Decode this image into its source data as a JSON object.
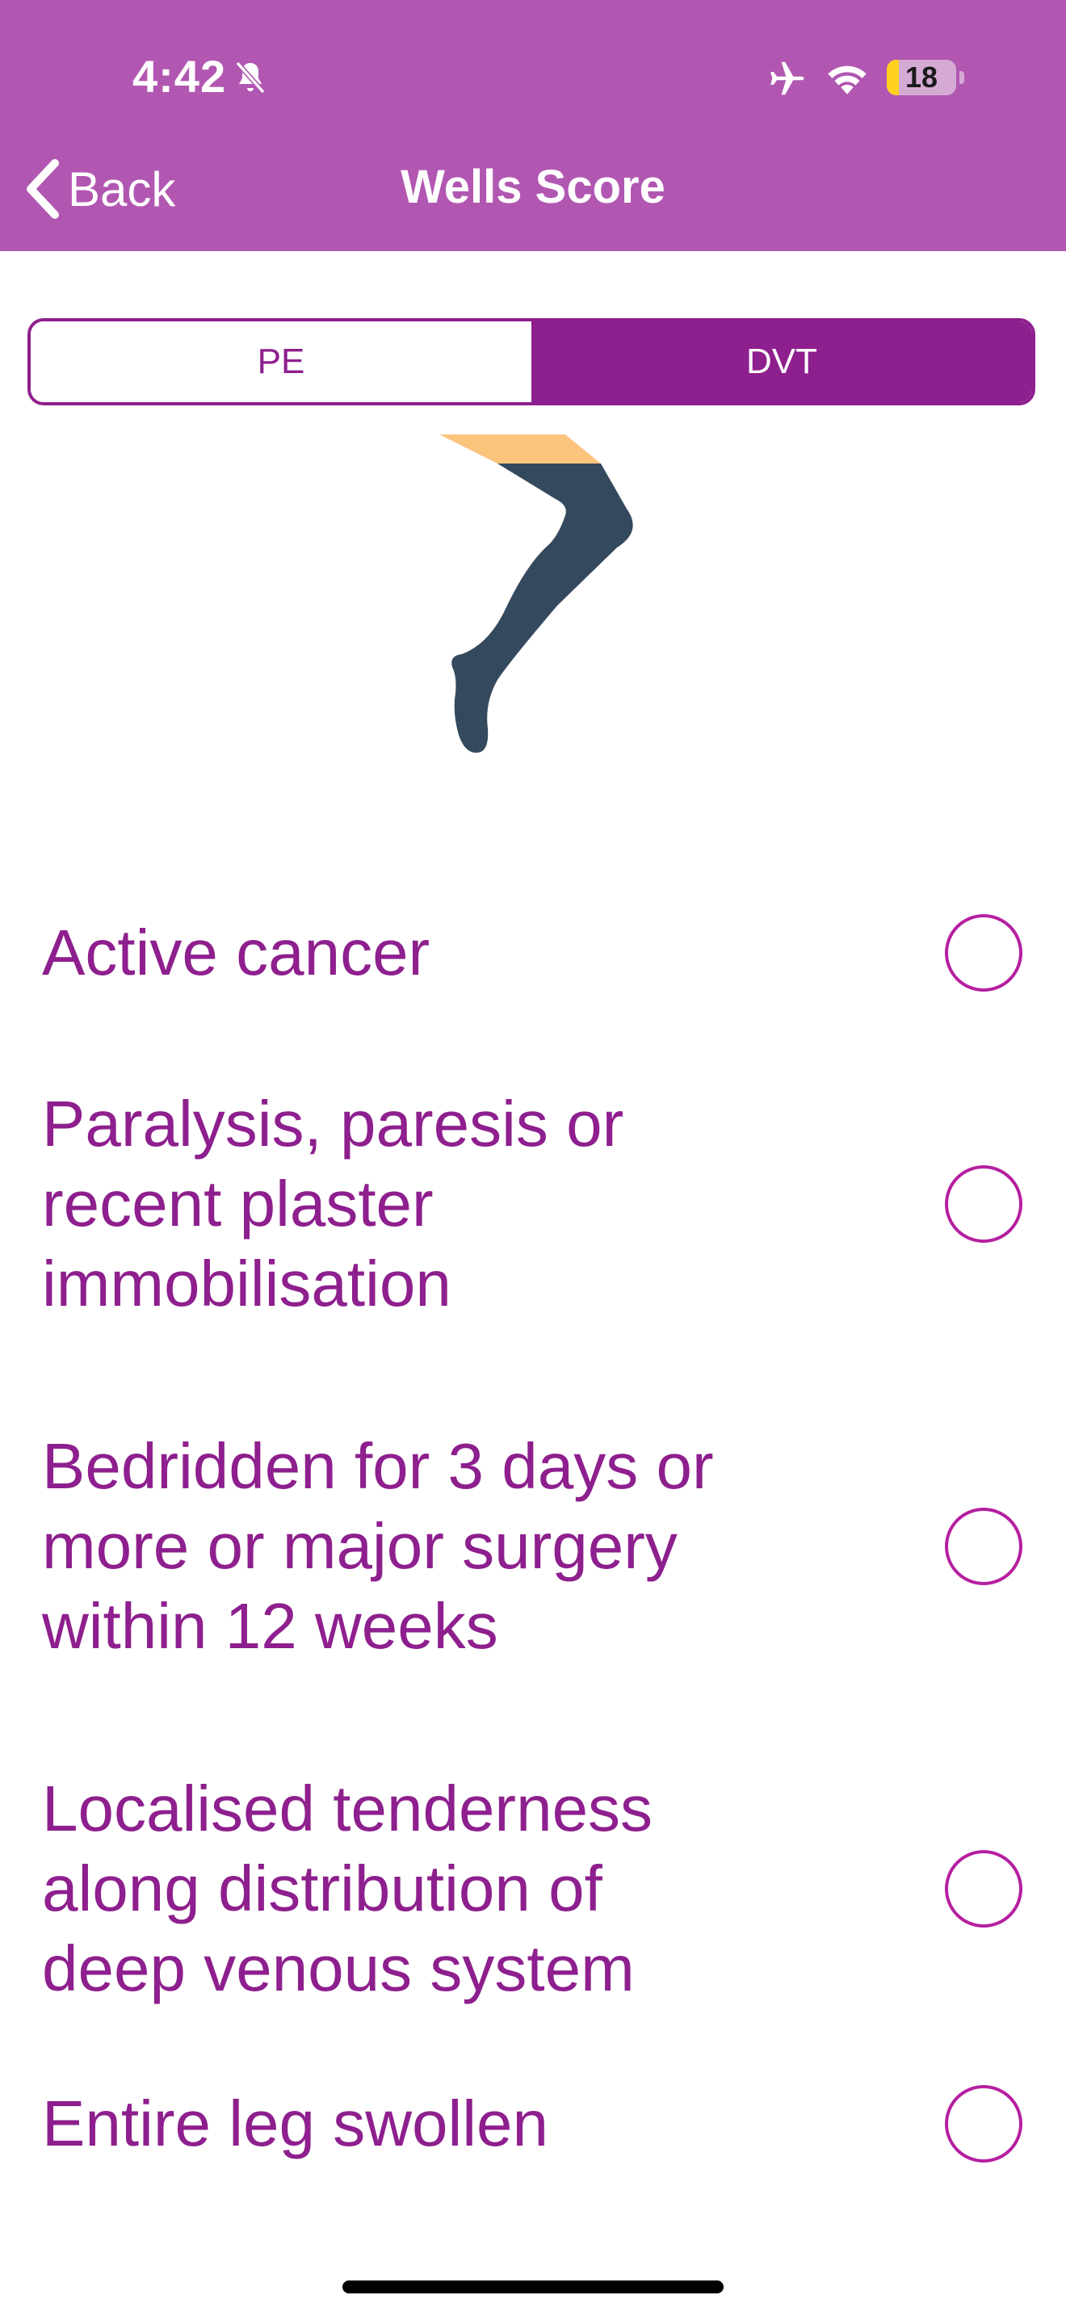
{
  "status_bar": {
    "time": "4:42",
    "battery_level": "18",
    "battery_fraction": 0.18,
    "icons": [
      "bell-slash-icon",
      "airplane-icon",
      "wifi-icon",
      "battery-icon"
    ]
  },
  "nav": {
    "back_label": "Back",
    "title": "Wells Score"
  },
  "tabs": [
    {
      "label": "PE",
      "selected": false
    },
    {
      "label": "DVT",
      "selected": true
    }
  ],
  "illustration": "leg-illustration",
  "criteria": [
    {
      "label": "Active cancer",
      "selected": false
    },
    {
      "label": "Paralysis, paresis or recent plaster immobilisation",
      "selected": false
    },
    {
      "label": "Bedridden for 3 days or more or major surgery within 12 weeks",
      "selected": false
    },
    {
      "label": "Localised tenderness along  distribution of deep venous system",
      "selected": false
    },
    {
      "label": "Entire leg swollen",
      "selected": false
    }
  ],
  "colors": {
    "header": "#b157b1",
    "accent": "#8e1f8e",
    "radio_border": "#b61fa0",
    "leg_stocking": "#35495e",
    "leg_skin": "#fbc47c"
  }
}
